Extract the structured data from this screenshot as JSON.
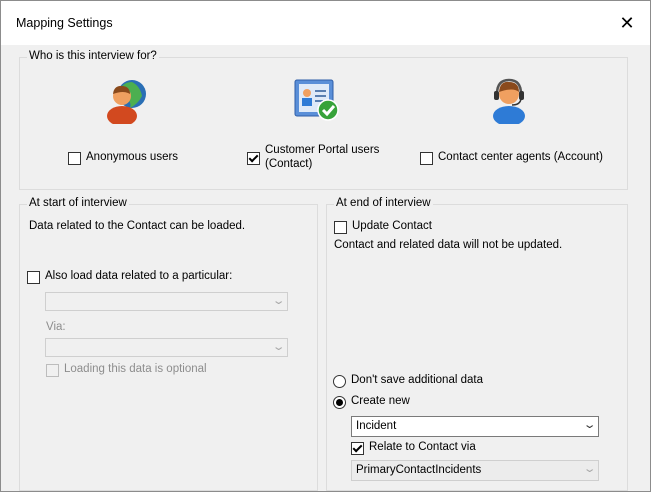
{
  "window": {
    "title": "Mapping Settings"
  },
  "audience": {
    "group_title": "Who is this interview for?",
    "anonymous": {
      "label": "Anonymous users",
      "checked": false,
      "icon": "user-globe-icon"
    },
    "portal": {
      "label_line1": "Customer Portal users",
      "label_line2": "(Contact)",
      "checked": true,
      "icon": "contact-card-check-icon"
    },
    "agents": {
      "label": "Contact center agents (Account)",
      "checked": false,
      "icon": "headset-agent-icon"
    }
  },
  "start": {
    "group_title": "At start of interview",
    "info": "Data related to the Contact can be loaded.",
    "also_load_label": "Also load data related to a particular:",
    "also_load_checked": false,
    "first_select_value": "",
    "via_label": "Via:",
    "via_select_value": "",
    "optional_label": "Loading this data is optional",
    "optional_checked": false
  },
  "end": {
    "group_title": "At end of interview",
    "update_label": "Update Contact",
    "update_checked": false,
    "update_info": "Contact and related data will not be updated.",
    "dont_save_label": "Don't save additional data",
    "create_new_label": "Create new",
    "selected_mode": "create_new",
    "entity_value": "Incident",
    "relate_label": "Relate to Contact via",
    "relate_checked": true,
    "relation_value": "PrimaryContactIncidents"
  }
}
